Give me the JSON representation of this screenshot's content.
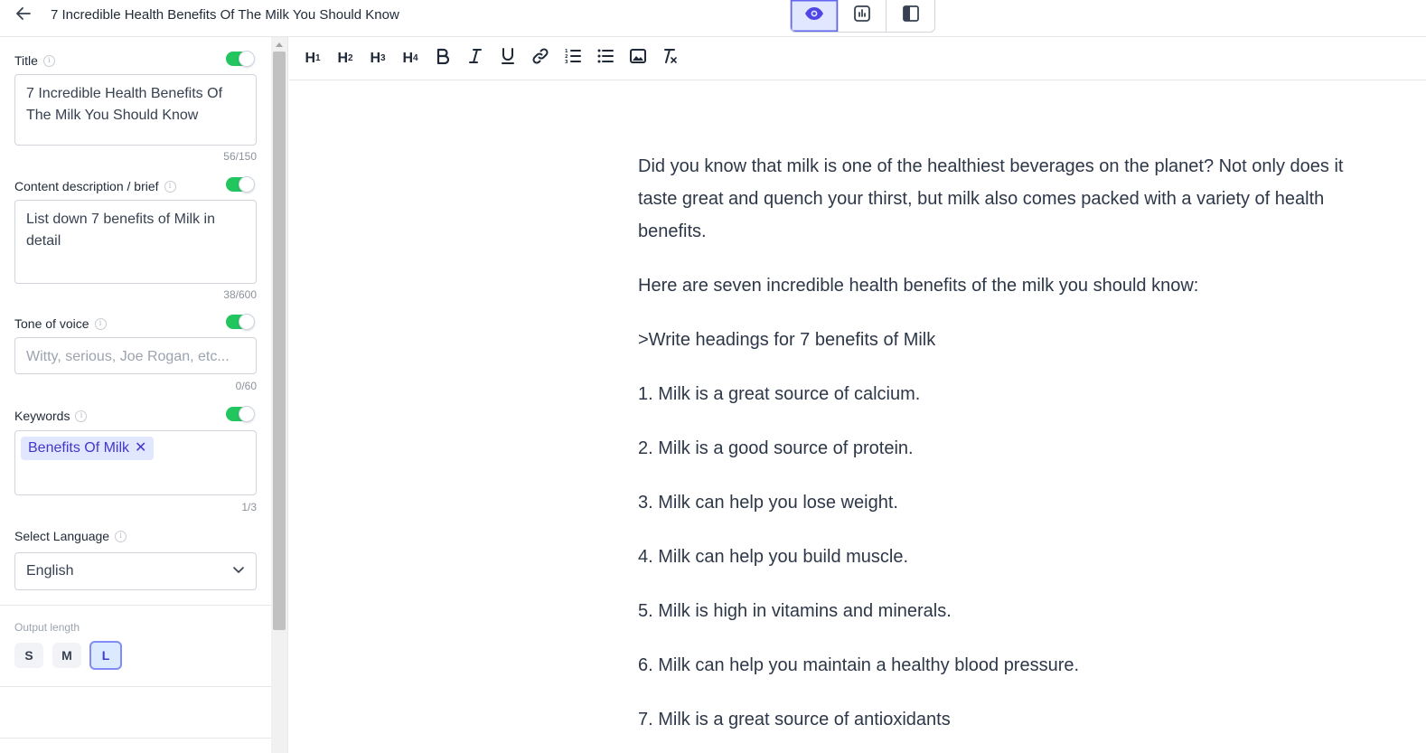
{
  "header": {
    "title": "7 Incredible Health Benefits Of The Milk You Should Know",
    "back_icon": "arrow-left-icon",
    "view_buttons": [
      {
        "icon": "eye-icon",
        "active": true
      },
      {
        "icon": "chart-icon",
        "active": false
      },
      {
        "icon": "sidebar-layout-icon",
        "active": false
      }
    ]
  },
  "sidebar": {
    "title": {
      "label": "Title",
      "value": "7 Incredible Health Benefits Of The Milk You Should Know",
      "counter": "56/150",
      "enabled": true
    },
    "description": {
      "label": "Content description / brief",
      "value": "List down 7 benefits of Milk in detail",
      "counter": "38/600",
      "enabled": true
    },
    "tone": {
      "label": "Tone of voice",
      "placeholder": "Witty, serious, Joe Rogan, etc...",
      "counter": "0/60",
      "enabled": true
    },
    "keywords": {
      "label": "Keywords",
      "chips": [
        "Benefits Of Milk"
      ],
      "counter": "1/3",
      "enabled": true
    },
    "language": {
      "label": "Select Language",
      "selected": "English"
    },
    "output_length": {
      "label": "Output length",
      "options": [
        "S",
        "M",
        "L"
      ],
      "selected": "L"
    }
  },
  "toolbar": {
    "buttons": [
      "H1",
      "H2",
      "H3",
      "H4",
      "bold-icon",
      "italic-icon",
      "underline-icon",
      "link-icon",
      "ordered-list-icon",
      "bullet-list-icon",
      "image-icon",
      "clear-format-icon"
    ]
  },
  "editor": {
    "paragraphs": [
      "Did you know that milk is one of the healthiest beverages on the planet? Not only does it taste great and quench your thirst, but milk also comes packed with a variety of health benefits.",
      "Here are seven incredible health benefits of the milk you should know:",
      ">Write headings for 7 benefits of Milk",
      "1. Milk is a great source of calcium.",
      "2. Milk is a good source of protein.",
      "3. Milk can help you lose weight.",
      "4. Milk can help you build muscle.",
      "5. Milk is high in vitamins and minerals.",
      "6. Milk can help you maintain a healthy blood pressure.",
      "7. Milk is a great source of antioxidants"
    ]
  },
  "colors": {
    "accent": "#6366f1",
    "toggle_on": "#22c55e",
    "chip_bg": "#e0e7ff",
    "chip_text": "#4338ca"
  }
}
